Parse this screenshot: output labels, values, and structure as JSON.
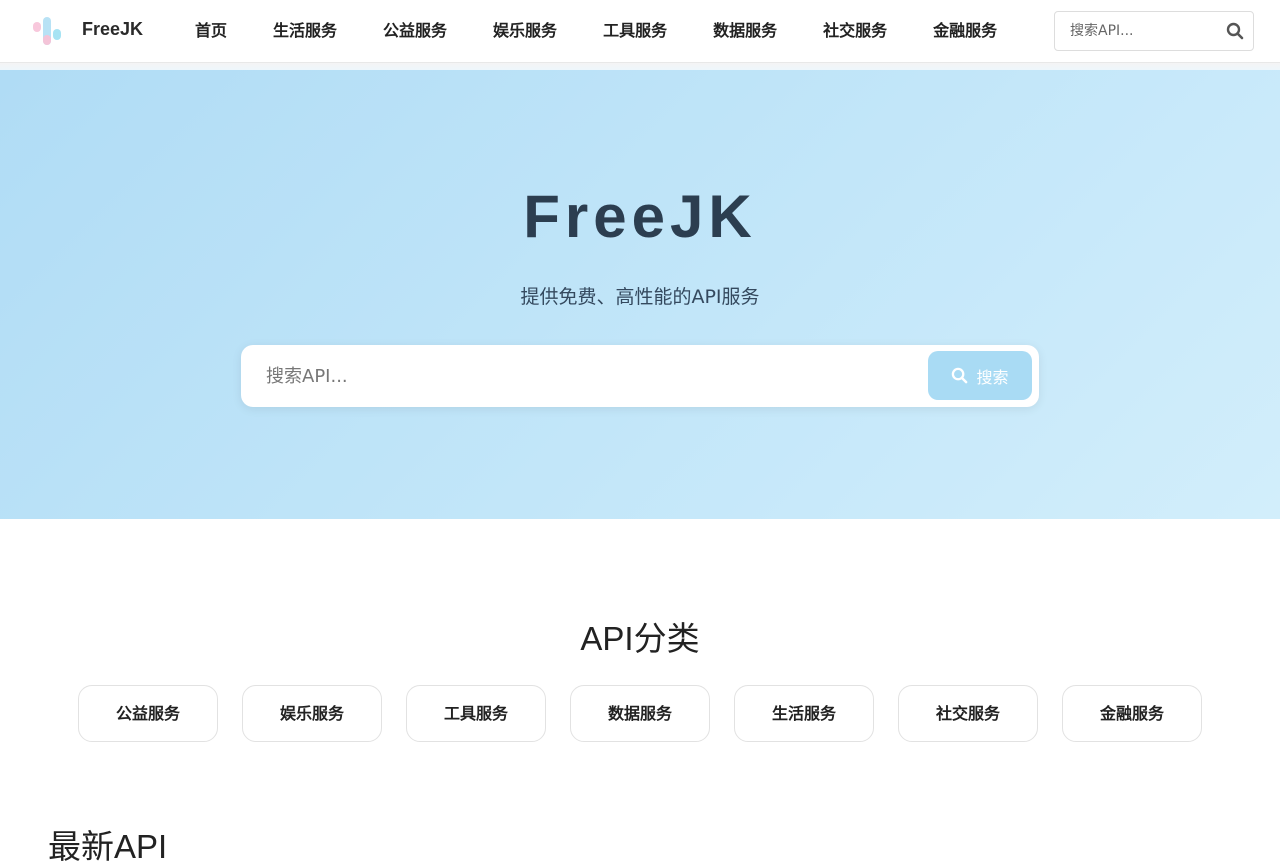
{
  "header": {
    "brand": "FreeJK",
    "nav": [
      "首页",
      "生活服务",
      "公益服务",
      "娱乐服务",
      "工具服务",
      "数据服务",
      "社交服务",
      "金融服务"
    ],
    "search_placeholder": "搜索API...",
    "search_icon": "search-icon"
  },
  "hero": {
    "title": "FreeJK",
    "subtitle": "提供免费、高性能的API服务",
    "search_placeholder": "搜索API...",
    "search_button": "搜索",
    "search_icon": "search-icon"
  },
  "categories": {
    "title": "API分类",
    "items": [
      "公益服务",
      "娱乐服务",
      "工具服务",
      "数据服务",
      "生活服务",
      "社交服务",
      "金融服务"
    ]
  },
  "latest": {
    "title": "最新API"
  },
  "colors": {
    "accent": "#a9dbf4",
    "hero_title": "#2c3e50",
    "hero_gradient_start": "#b0dcf5",
    "hero_gradient_end": "#d2eefb"
  }
}
